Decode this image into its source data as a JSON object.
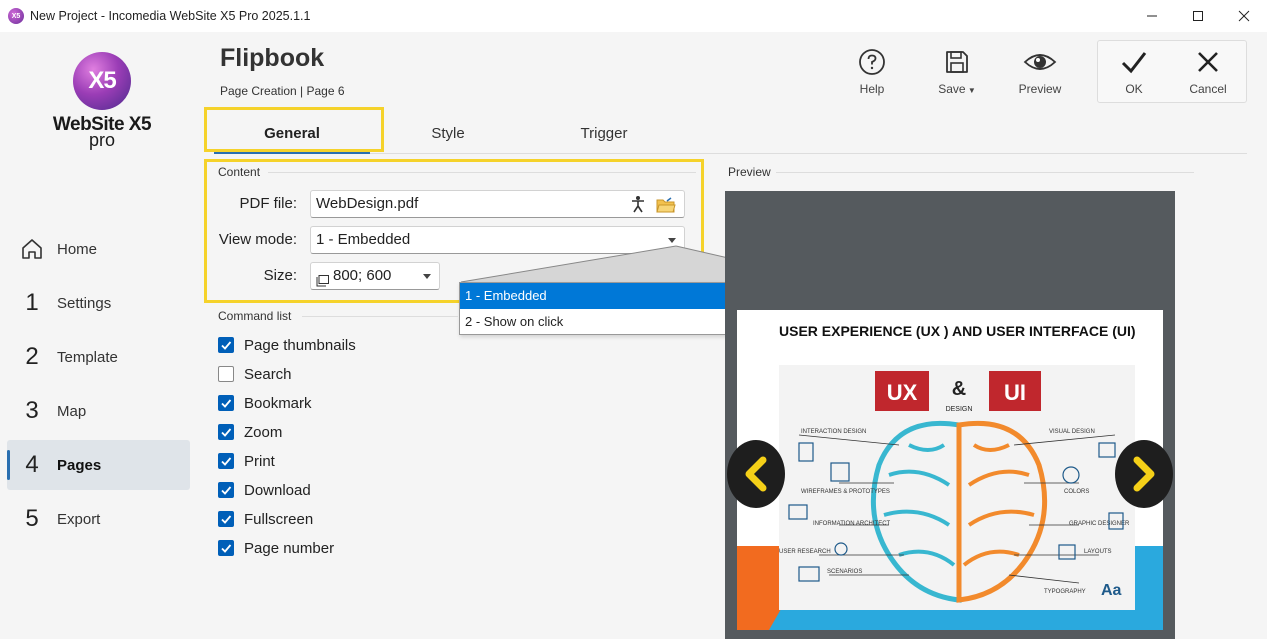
{
  "window": {
    "title": "New Project - Incomedia WebSite X5 Pro 2025.1.1",
    "app_icon_text": "X5"
  },
  "logo": {
    "badge": "X5",
    "name": "WebSite X5",
    "edition": "pro"
  },
  "nav": {
    "home": "Home",
    "items": [
      {
        "num": "1",
        "label": "Settings"
      },
      {
        "num": "2",
        "label": "Template"
      },
      {
        "num": "3",
        "label": "Map"
      },
      {
        "num": "4",
        "label": "Pages"
      },
      {
        "num": "5",
        "label": "Export"
      }
    ]
  },
  "header": {
    "title": "Flipbook",
    "breadcrumb": "Page Creation | Page 6"
  },
  "toolbar": {
    "help": "Help",
    "save": "Save",
    "preview": "Preview",
    "ok": "OK",
    "cancel": "Cancel"
  },
  "tabs": {
    "general": "General",
    "style": "Style",
    "trigger": "Trigger"
  },
  "content": {
    "group_label": "Content",
    "pdf_label": "PDF file:",
    "pdf_value": "WebDesign.pdf",
    "view_mode_label": "View mode:",
    "view_mode_value": "1 - Embedded",
    "size_label": "Size:",
    "size_value": "800; 600"
  },
  "dropdown": {
    "options": [
      "1 - Embedded",
      "2 - Show on click"
    ]
  },
  "commands": {
    "group_label": "Command list",
    "items": [
      {
        "label": "Page thumbnails",
        "checked": true
      },
      {
        "label": "Search",
        "checked": false
      },
      {
        "label": "Bookmark",
        "checked": true
      },
      {
        "label": "Zoom",
        "checked": true
      },
      {
        "label": "Print",
        "checked": true
      },
      {
        "label": "Download",
        "checked": true
      },
      {
        "label": "Fullscreen",
        "checked": true
      },
      {
        "label": "Page number",
        "checked": true
      }
    ]
  },
  "preview": {
    "label": "Preview",
    "page_heading": "USER EXPERIENCE (UX ) AND USER INTERFACE (UI)",
    "graphic": {
      "ux": "UX",
      "amp": "&",
      "ui": "UI",
      "design": "DESIGN",
      "left_labels": [
        "INTERACTION DESIGN",
        "WIREFRAMES & PROTOTYPES",
        "INFORMATION ARCHITECT",
        "USER RESEARCH",
        "SCENARIOS"
      ],
      "right_labels": [
        "VISUAL DESIGN",
        "COLORS",
        "GRAPHIC DESIGNER",
        "LAYOUTS",
        "TYPOGRAPHY"
      ],
      "typography_glyph": "Aa"
    }
  },
  "colors": {
    "accent": "#2a6fb0",
    "highlight": "#f5d22a",
    "selected": "#0078d7",
    "checkbox": "#005fb8"
  }
}
